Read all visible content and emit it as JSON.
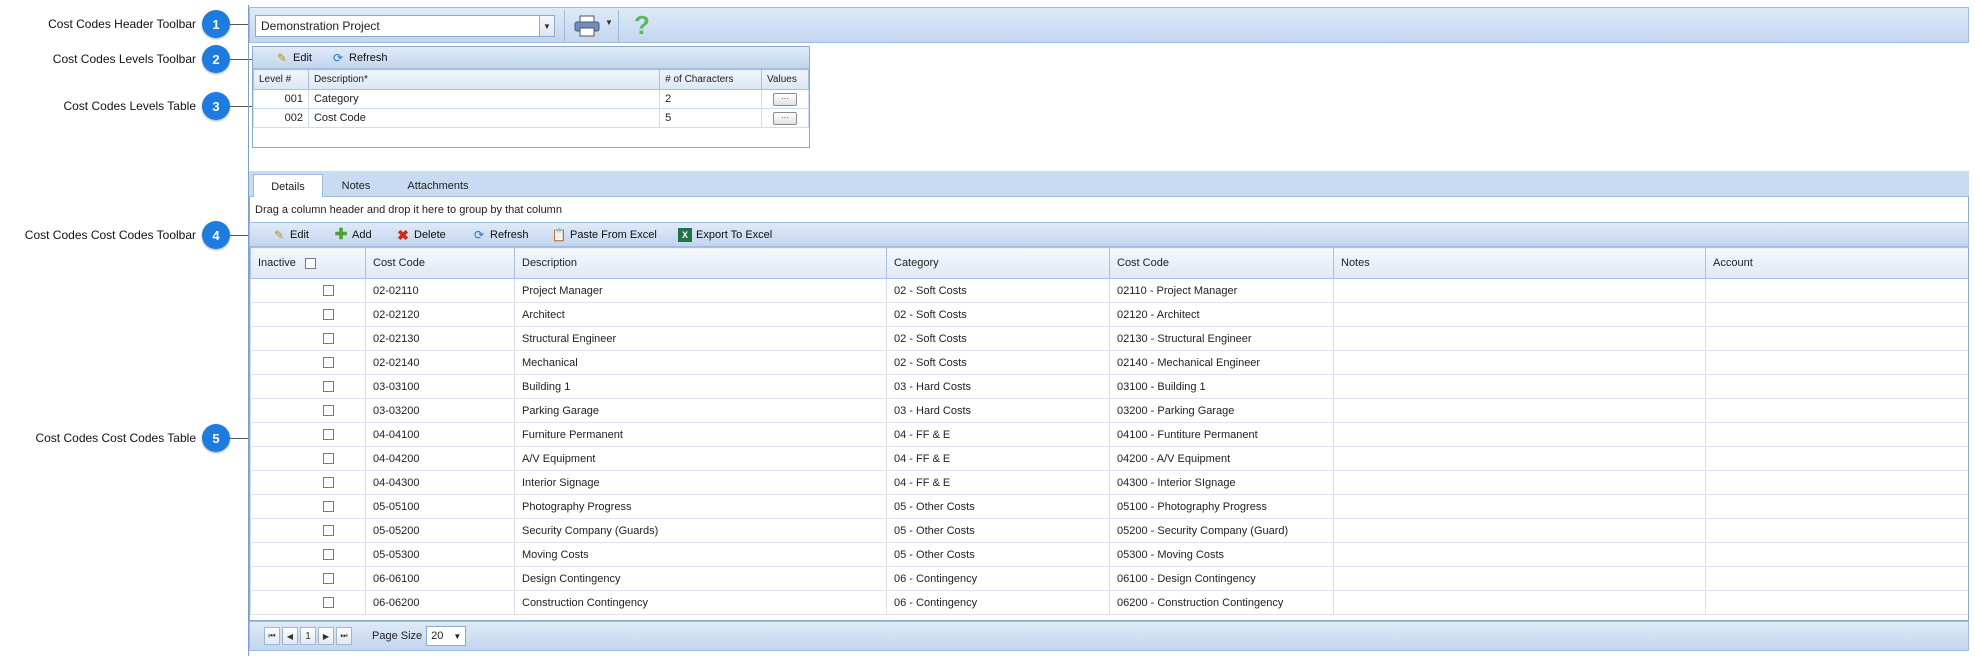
{
  "callouts": [
    {
      "num": "1",
      "label": "Cost Codes Header Toolbar"
    },
    {
      "num": "2",
      "label": "Cost Codes Levels Toolbar"
    },
    {
      "num": "3",
      "label": "Cost Codes Levels Table"
    },
    {
      "num": "4",
      "label": "Cost Codes Cost Codes Toolbar"
    },
    {
      "num": "5",
      "label": "Cost Codes Cost Codes Table"
    }
  ],
  "header": {
    "project_value": "Demonstration Project",
    "help_glyph": "?"
  },
  "levels_toolbar": {
    "edit": "Edit",
    "refresh": "Refresh"
  },
  "levels_table": {
    "columns": [
      "Level #",
      "Description*",
      "# of Characters",
      "Values"
    ],
    "rows": [
      {
        "level": "001",
        "description": "Category",
        "chars": "2",
        "values": "···"
      },
      {
        "level": "002",
        "description": "Cost Code",
        "chars": "5",
        "values": "···"
      }
    ]
  },
  "tabs": [
    "Details",
    "Notes",
    "Attachments"
  ],
  "group_hint": "Drag a column header and drop it here to group by that column",
  "cc_toolbar": {
    "edit": "Edit",
    "add": "Add",
    "delete": "Delete",
    "refresh": "Refresh",
    "paste": "Paste From Excel",
    "export": "Export To Excel"
  },
  "cc_table": {
    "columns": [
      "Inactive",
      "Cost Code",
      "Description",
      "Category",
      "Cost Code",
      "Notes",
      "Account"
    ],
    "rows": [
      [
        "02-02110",
        "Project Manager",
        "02 - Soft Costs",
        "02110 - Project Manager"
      ],
      [
        "02-02120",
        "Architect",
        "02 - Soft Costs",
        "02120 - Architect"
      ],
      [
        "02-02130",
        "Structural Engineer",
        "02 - Soft Costs",
        "02130 - Structural Engineer"
      ],
      [
        "02-02140",
        "Mechanical",
        "02 - Soft Costs",
        "02140 - Mechanical Engineer"
      ],
      [
        "03-03100",
        "Building 1",
        "03 - Hard Costs",
        "03100 - Building 1"
      ],
      [
        "03-03200",
        "Parking Garage",
        "03 - Hard Costs",
        "03200 - Parking Garage"
      ],
      [
        "04-04100",
        "Furniture Permanent",
        "04 - FF & E",
        "04100 - Funtiture Permanent"
      ],
      [
        "04-04200",
        "A/V Equipment",
        "04 - FF & E",
        "04200 - A/V Equipment"
      ],
      [
        "04-04300",
        "Interior Signage",
        "04 - FF & E",
        "04300 - Interior SIgnage"
      ],
      [
        "05-05100",
        "Photography Progress",
        "05 - Other Costs",
        "05100 - Photography Progress"
      ],
      [
        "05-05200",
        "Security Company (Guards)",
        "05 - Other Costs",
        "05200 - Security Company (Guard)"
      ],
      [
        "05-05300",
        "Moving Costs",
        "05 - Other Costs",
        "05300 - Moving Costs"
      ],
      [
        "06-06100",
        "Design Contingency",
        "06 - Contingency",
        "06100 - Design Contingency"
      ],
      [
        "06-06200",
        "Construction Contingency",
        "06 - Contingency",
        "06200 - Construction Contingency"
      ]
    ]
  },
  "pager": {
    "page": "1",
    "page_size_label": "Page Size",
    "page_size": "20"
  }
}
